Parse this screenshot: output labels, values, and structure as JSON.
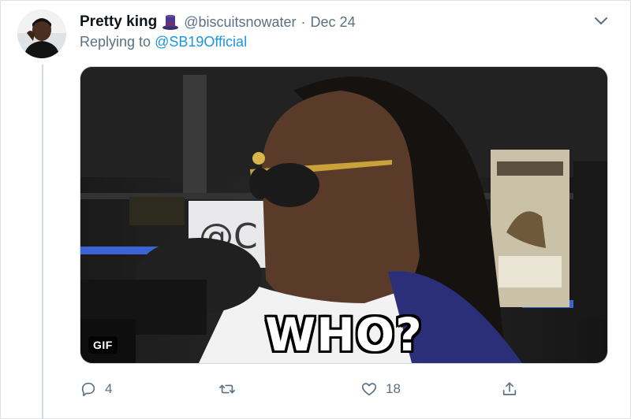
{
  "tweet": {
    "display_name": "Pretty king",
    "name_emoji": "top-hat-emoji",
    "handle": "@biscuitsnowater",
    "separator": "·",
    "date": "Dec 24",
    "replying_prefix": "Replying to",
    "replying_to": "@SB19Official",
    "media": {
      "type_badge": "GIF",
      "caption": "WHO?"
    },
    "actions": {
      "reply_count": "4",
      "retweet_count": "",
      "like_count": "18"
    }
  },
  "colors": {
    "link": "#1b95e0",
    "muted": "#5b7083",
    "divider": "#cfd9de"
  }
}
